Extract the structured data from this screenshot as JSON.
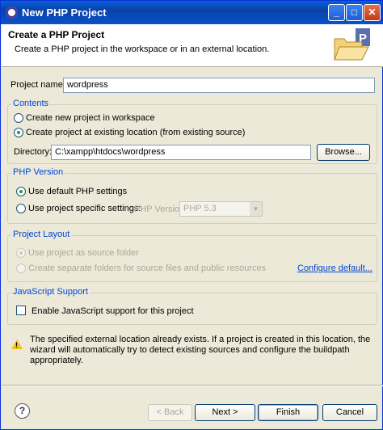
{
  "window": {
    "title": "New PHP Project"
  },
  "header": {
    "title": "Create a PHP Project",
    "description": "Create a PHP project in the workspace or in an external location."
  },
  "project_name": {
    "label": "Project name:",
    "value": "wordpress"
  },
  "contents": {
    "legend": "Contents",
    "option_new": "Create new project in workspace",
    "option_existing": "Create project at existing location (from existing source)",
    "selected": "existing",
    "directory_label": "Directory:",
    "directory_value": "C:\\xampp\\htdocs\\wordpress",
    "browse_label": "Browse..."
  },
  "php_version": {
    "legend": "PHP Version",
    "option_default": "Use default PHP settings",
    "option_specific": "Use project specific settings:",
    "version_label": "PHP Version:",
    "version_value": "PHP 5.3"
  },
  "project_layout": {
    "legend": "Project Layout",
    "option_source": "Use project as source folder",
    "option_separate": "Create separate folders for source files and public resources",
    "configure_link": "Configure default..."
  },
  "javascript": {
    "legend": "JavaScript Support",
    "checkbox_label": "Enable JavaScript support for this project"
  },
  "warning": {
    "text": "The specified external location already exists. If a project is created in this location, the wizard will automatically try to detect existing sources and configure the buildpath appropriately."
  },
  "buttons": {
    "back": "< Back",
    "next": "Next >",
    "finish": "Finish",
    "cancel": "Cancel"
  },
  "icons": {
    "help": "?",
    "minimize": "_",
    "maximize": "□",
    "close": "✕"
  }
}
